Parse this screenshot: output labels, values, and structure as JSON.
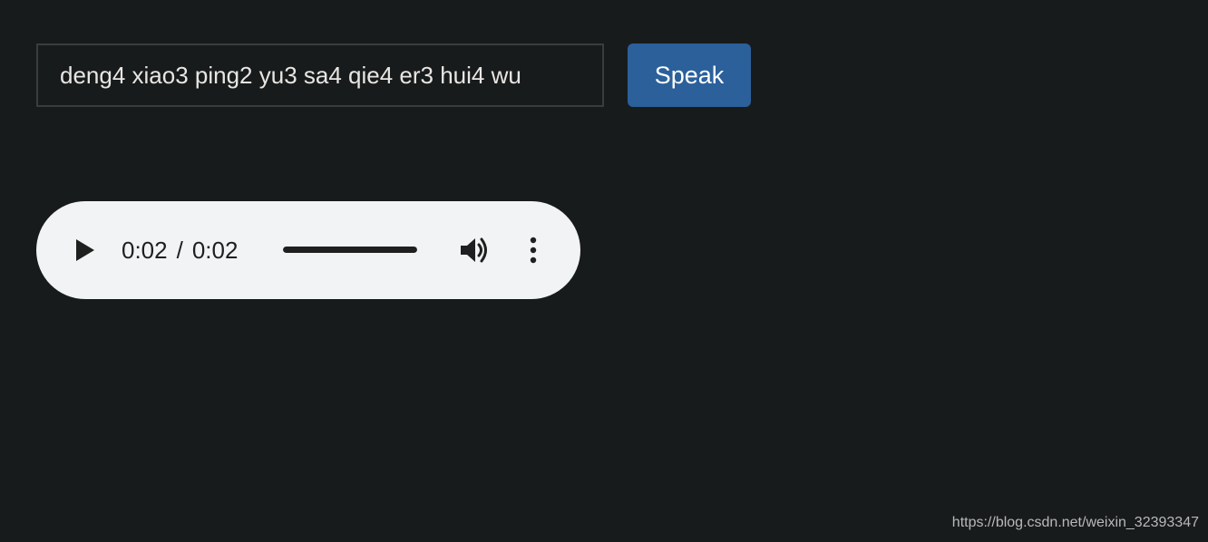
{
  "form": {
    "input_value": "deng4 xiao3 ping2 yu3 sa4 qie4 er3 hui4 wu",
    "speak_label": "Speak"
  },
  "audio": {
    "current_time": "0:02",
    "separator": "/",
    "duration": "0:02",
    "progress": 1.0,
    "icons": {
      "play": "play-icon",
      "volume": "volume-icon",
      "menu": "more-vert-icon"
    }
  },
  "watermark": {
    "text": "https://blog.csdn.net/weixin_32393347"
  },
  "colors": {
    "page_background": "#181b1c",
    "button_background": "#2b609b",
    "player_background": "#f1f3f4"
  }
}
